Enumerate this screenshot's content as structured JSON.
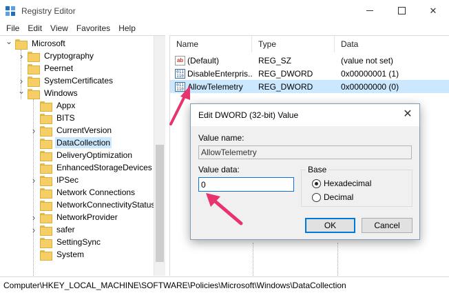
{
  "window": {
    "title": "Registry Editor",
    "controls": {
      "minimize": "",
      "maximize": "",
      "close": "✕"
    }
  },
  "menu": [
    "File",
    "Edit",
    "View",
    "Favorites",
    "Help"
  ],
  "tree": {
    "items": [
      {
        "label": "Microsoft",
        "expander": "open",
        "selected": false
      },
      {
        "label": "Cryptography",
        "expander": "closed",
        "selected": false
      },
      {
        "label": "Peernet",
        "expander": "",
        "selected": false
      },
      {
        "label": "SystemCertificates",
        "expander": "closed",
        "selected": false
      },
      {
        "label": "Windows",
        "expander": "open",
        "selected": false
      },
      {
        "label": "Appx",
        "expander": "",
        "selected": false
      },
      {
        "label": "BITS",
        "expander": "",
        "selected": false
      },
      {
        "label": "CurrentVersion",
        "expander": "closed",
        "selected": false
      },
      {
        "label": "DataCollection",
        "expander": "",
        "selected": true
      },
      {
        "label": "DeliveryOptimization",
        "expander": "",
        "selected": false
      },
      {
        "label": "EnhancedStorageDevices",
        "expander": "",
        "selected": false
      },
      {
        "label": "IPSec",
        "expander": "closed",
        "selected": false
      },
      {
        "label": "Network Connections",
        "expander": "",
        "selected": false
      },
      {
        "label": "NetworkConnectivityStatus",
        "expander": "",
        "selected": false
      },
      {
        "label": "NetworkProvider",
        "expander": "closed",
        "selected": false
      },
      {
        "label": "safer",
        "expander": "closed",
        "selected": false
      },
      {
        "label": "SettingSync",
        "expander": "",
        "selected": false
      },
      {
        "label": "System",
        "expander": "",
        "selected": false
      }
    ]
  },
  "list": {
    "columns": {
      "name": "Name",
      "type": "Type",
      "data": "Data"
    },
    "rows": [
      {
        "icon": "string-value-icon",
        "icon_text": "ab",
        "name": "(Default)",
        "type": "REG_SZ",
        "data": "(value not set)",
        "selected": false
      },
      {
        "icon": "binary-value-icon",
        "icon_text": "011 110",
        "name": "DisableEnterpris...",
        "type": "REG_DWORD",
        "data": "0x00000001 (1)",
        "selected": false
      },
      {
        "icon": "binary-value-icon",
        "icon_text": "011 110",
        "name": "AllowTelemetry",
        "type": "REG_DWORD",
        "data": "0x00000000 (0)",
        "selected": true
      }
    ]
  },
  "statusbar": {
    "path": "Computer\\HKEY_LOCAL_MACHINE\\SOFTWARE\\Policies\\Microsoft\\Windows\\DataCollection"
  },
  "dialog": {
    "title": "Edit DWORD (32-bit) Value",
    "close": "✕",
    "value_name_label": "Value name:",
    "value_name": "AllowTelemetry",
    "value_data_label": "Value data:",
    "value_data": "0",
    "base_label": "Base",
    "radios": [
      {
        "label": "Hexadecimal",
        "checked": true
      },
      {
        "label": "Decimal",
        "checked": false
      }
    ],
    "ok_label": "OK",
    "cancel_label": "Cancel"
  },
  "colors": {
    "selection": "#cce8ff",
    "annotation_arrow": "#e8336d",
    "focus_border": "#0078d7"
  }
}
